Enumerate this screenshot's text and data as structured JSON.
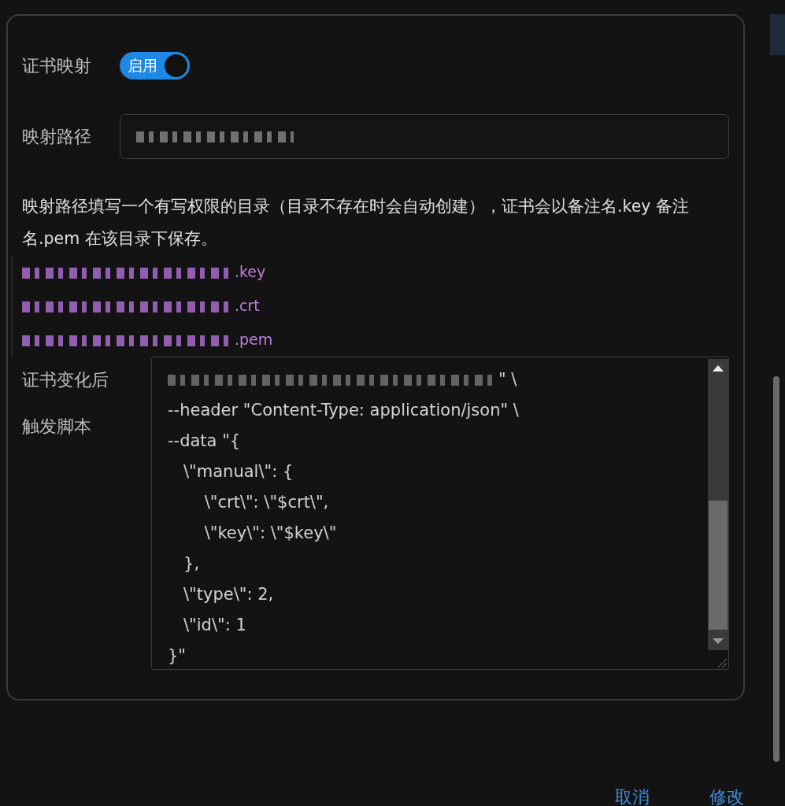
{
  "mapping": {
    "label": "证书映射",
    "toggle": {
      "on": true,
      "text": "启用"
    }
  },
  "path": {
    "label": "映射路径",
    "value_redacted": true
  },
  "description": "映射路径填写一个有写权限的目录（目录不存在时会自动创建），证书会以备注名.key 备注名.pem 在该目录下保存。",
  "files": [
    {
      "text": ".key",
      "redacted": true
    },
    {
      "text": ".crt",
      "redacted": true
    },
    {
      "text": ".pem",
      "redacted": true
    }
  ],
  "script": {
    "label_lines": [
      "证书变化后",
      "触发脚本"
    ],
    "lines": [
      {
        "text": "\" \\",
        "redacted": true
      },
      {
        "text": "--header \"Content-Type: application/json\" \\",
        "redacted": false
      },
      {
        "text": "--data \"{",
        "redacted": false
      },
      {
        "text": "   \\\"manual\\\": {",
        "redacted": false
      },
      {
        "text": "       \\\"crt\\\": \\\"$crt\\\",",
        "redacted": false
      },
      {
        "text": "       \\\"key\\\": \\\"$key\\\"",
        "redacted": false
      },
      {
        "text": "   },",
        "redacted": false
      },
      {
        "text": "   \\\"type\\\": 2,",
        "redacted": false
      },
      {
        "text": "   \\\"id\\\": 1",
        "redacted": false
      },
      {
        "text": "}\"",
        "redacted": false
      }
    ]
  },
  "buttons": [
    {
      "label": "取消"
    },
    {
      "label": "修改"
    }
  ]
}
